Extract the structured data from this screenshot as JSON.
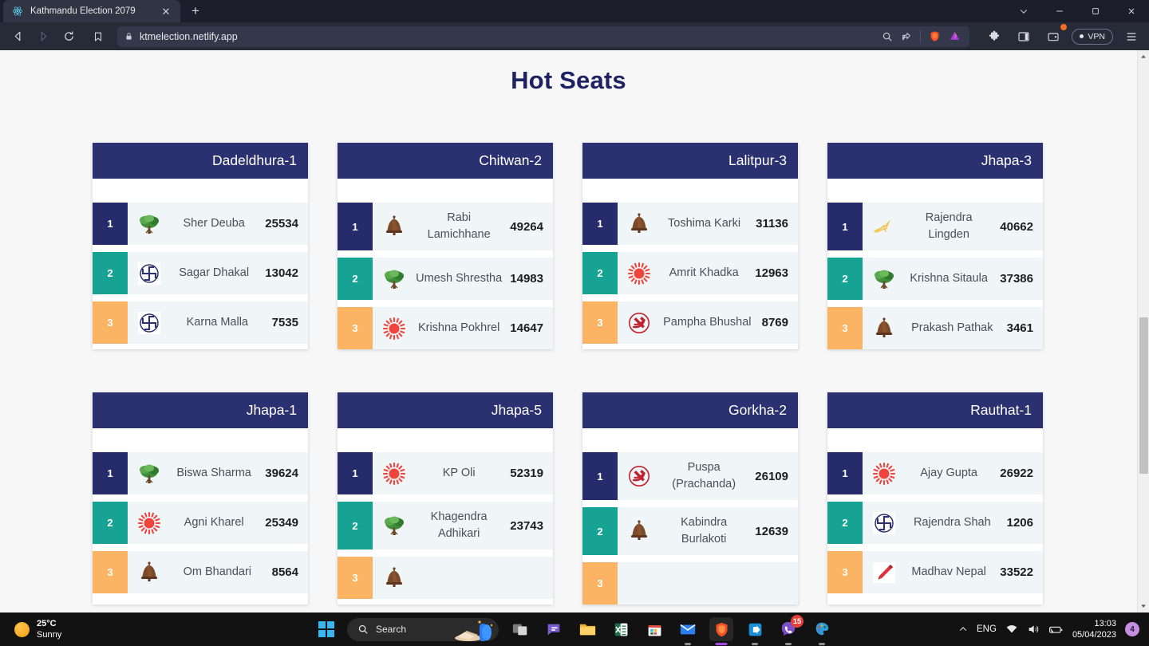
{
  "browser": {
    "tab": {
      "title": "Kathmandu Election 2079",
      "favicon": "react-logo-icon",
      "close": "✕"
    },
    "new_tab_label": "+",
    "window_controls": {
      "tab_search": "⌄",
      "minimize": "–",
      "maximize": "❐",
      "close": "✕"
    },
    "nav": {
      "back": "back-icon",
      "forward": "forward-icon",
      "reload": "reload-icon",
      "bookmark": "bookmark-icon"
    },
    "omnibox": {
      "url": "ktmelection.netlify.app",
      "lock": "lock-icon"
    },
    "omnibox_actions": [
      "search-icon",
      "share-icon",
      "brave-shields-icon",
      "brave-rewards-icon"
    ],
    "toolbar_right": [
      "extensions-icon",
      "sidebar-icon",
      "wallet-icon"
    ],
    "vpn_label": "VPN",
    "menu": "hamburger-menu-icon"
  },
  "page": {
    "title": "Hot Seats",
    "cards": [
      {
        "constituency": "Dadeldhura-1",
        "rows": [
          {
            "rank": "1",
            "symbol": "tree-symbol",
            "name": "Sher Deuba",
            "votes": "25534"
          },
          {
            "rank": "2",
            "symbol": "swastika-symbol",
            "name": "Sagar Dhakal",
            "votes": "13042"
          },
          {
            "rank": "3",
            "symbol": "swastika-symbol",
            "name": "Karna Malla",
            "votes": "7535"
          }
        ]
      },
      {
        "constituency": "Chitwan-2",
        "rows": [
          {
            "rank": "1",
            "symbol": "bell-symbol",
            "name": "Rabi Lamichhane",
            "votes": "49264"
          },
          {
            "rank": "2",
            "symbol": "tree-symbol",
            "name": "Umesh Shrestha",
            "votes": "14983"
          },
          {
            "rank": "3",
            "symbol": "sun-symbol",
            "name": "Krishna Pokhrel",
            "votes": "14647"
          }
        ]
      },
      {
        "constituency": "Lalitpur-3",
        "rows": [
          {
            "rank": "1",
            "symbol": "bell-symbol",
            "name": "Toshima Karki",
            "votes": "31136"
          },
          {
            "rank": "2",
            "symbol": "sun-symbol",
            "name": "Amrit Khadka",
            "votes": "12963"
          },
          {
            "rank": "3",
            "symbol": "hammer-sickle-symbol",
            "name": "Pampha Bhushal",
            "votes": "8769"
          }
        ]
      },
      {
        "constituency": "Jhapa-3",
        "rows": [
          {
            "rank": "1",
            "symbol": "plough-symbol",
            "name": "Rajendra Lingden",
            "votes": "40662"
          },
          {
            "rank": "2",
            "symbol": "tree-symbol",
            "name": "Krishna Sitaula",
            "votes": "37386"
          },
          {
            "rank": "3",
            "symbol": "bell-symbol",
            "name": "Prakash Pathak",
            "votes": "3461"
          }
        ]
      },
      {
        "constituency": "Jhapa-1",
        "rows": [
          {
            "rank": "1",
            "symbol": "tree-symbol",
            "name": "Biswa Sharma",
            "votes": "39624"
          },
          {
            "rank": "2",
            "symbol": "sun-symbol",
            "name": "Agni Kharel",
            "votes": "25349"
          },
          {
            "rank": "3",
            "symbol": "bell-symbol",
            "name": "Om Bhandari",
            "votes": "8564"
          }
        ]
      },
      {
        "constituency": "Jhapa-5",
        "rows": [
          {
            "rank": "1",
            "symbol": "sun-symbol",
            "name": "KP Oli",
            "votes": "52319"
          },
          {
            "rank": "2",
            "symbol": "tree-symbol",
            "name": "Khagendra Adhikari",
            "votes": "23743"
          },
          {
            "rank": "3",
            "symbol": "bell-symbol",
            "name": "",
            "votes": ""
          }
        ]
      },
      {
        "constituency": "Gorkha-2",
        "rows": [
          {
            "rank": "1",
            "symbol": "hammer-sickle-symbol",
            "name": "Puspa (Prachanda)",
            "votes": "26109"
          },
          {
            "rank": "2",
            "symbol": "bell-symbol",
            "name": "Kabindra Burlakoti",
            "votes": "12639"
          },
          {
            "rank": "3",
            "symbol": "",
            "name": "",
            "votes": ""
          }
        ]
      },
      {
        "constituency": "Rauthat-1",
        "rows": [
          {
            "rank": "1",
            "symbol": "sun-symbol",
            "name": "Ajay Gupta",
            "votes": "26922"
          },
          {
            "rank": "2",
            "symbol": "swastika-symbol",
            "name": "Rajendra Shah",
            "votes": "1206"
          },
          {
            "rank": "3",
            "symbol": "pen-symbol",
            "name": "Madhav Nepal",
            "votes": "33522"
          }
        ]
      }
    ]
  },
  "taskbar": {
    "weather": {
      "temperature": "25°C",
      "condition": "Sunny",
      "icon": "sun-icon"
    },
    "start": "windows-start-icon",
    "search_placeholder": "Search",
    "apps": [
      {
        "name": "task-view-icon"
      },
      {
        "name": "chat-icon"
      },
      {
        "name": "file-explorer-icon"
      },
      {
        "name": "excel-icon"
      },
      {
        "name": "microsoft-store-icon"
      },
      {
        "name": "mail-icon"
      },
      {
        "name": "brave-browser-icon"
      },
      {
        "name": "blue-app-icon"
      },
      {
        "name": "viber-icon",
        "badge": "15"
      },
      {
        "name": "paint-icon"
      }
    ],
    "tray": {
      "overflow": "chevron-up-icon",
      "language": "ENG",
      "wifi": "wifi-icon",
      "volume": "speaker-icon",
      "battery": "battery-icon",
      "time": "13:03",
      "date": "05/04/2023",
      "notifications": "4"
    }
  },
  "colors": {
    "header_navy": "#2b3170",
    "rank1": "#252b6b",
    "rank2": "#16a394",
    "rank3": "#fbb463",
    "row_bg": "#f0f5f7",
    "title": "#1d2362"
  }
}
